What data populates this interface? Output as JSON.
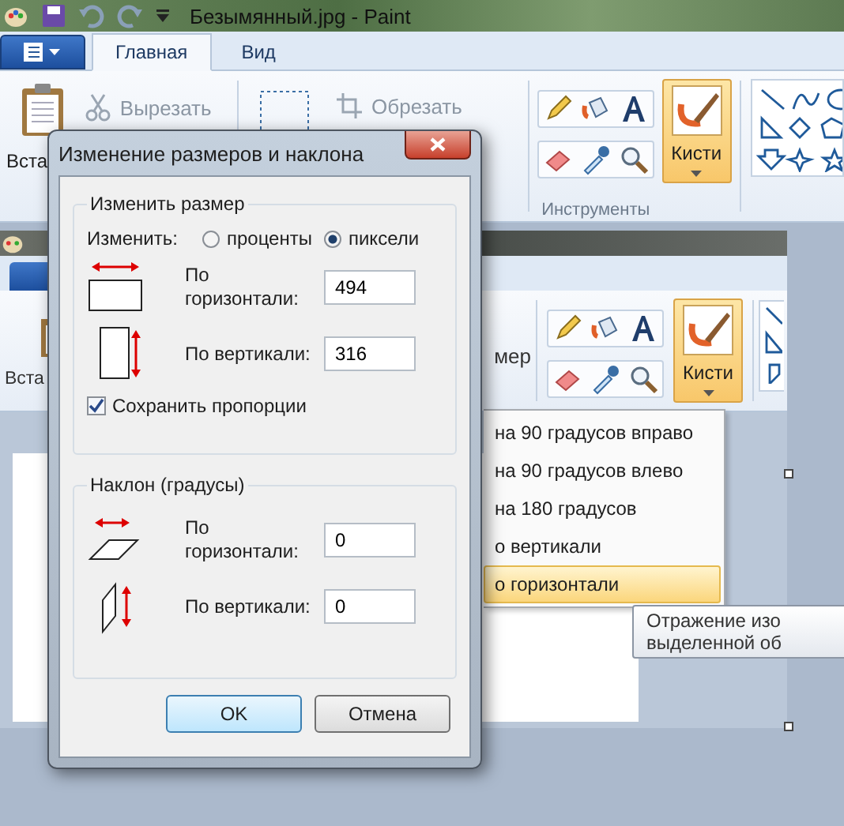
{
  "window": {
    "title": "Безымянный.jpg - Paint"
  },
  "ribbon": {
    "tabs": [
      {
        "label": "Главная",
        "selected": true
      },
      {
        "label": "Вид",
        "selected": false
      }
    ],
    "paste": "Вста",
    "cut": "Вырезать",
    "crop": "Обрезать",
    "tools_label": "Инструменты",
    "brushes": {
      "label": "Кисти",
      "selected": true
    }
  },
  "canvas_image": {
    "paste": "Вста",
    "resize_fragment": "мер",
    "brushes": "Кисти",
    "menu": [
      {
        "label": "на 90 градусов вправо",
        "selected": false
      },
      {
        "label": "на 90 градусов влево",
        "selected": false
      },
      {
        "label": "на 180 градусов",
        "selected": false
      },
      {
        "label": "о вертикали",
        "selected": false
      },
      {
        "label": "о горизонтали",
        "selected": true
      }
    ],
    "tooltip": "Отражение изо\nвыделенной об"
  },
  "dialog": {
    "title": "Изменение размеров и наклона",
    "resize": {
      "legend": "Изменить размер",
      "by_label": "Изменить:",
      "units": [
        {
          "label": "проценты",
          "selected": false
        },
        {
          "label": "пиксели",
          "selected": true
        }
      ],
      "fields": [
        {
          "label": "По горизонтали:",
          "value": "494"
        },
        {
          "label": "По вертикали:",
          "value": "316"
        }
      ],
      "keep_ratio": {
        "label": "Сохранить пропорции",
        "checked": true
      }
    },
    "skew": {
      "legend": "Наклон (градусы)",
      "fields": [
        {
          "label": "По горизонтали:",
          "value": "0"
        },
        {
          "label": "По вертикали:",
          "value": "0"
        }
      ]
    },
    "buttons": [
      {
        "label": "OK",
        "default": true
      },
      {
        "label": "Отмена",
        "default": false
      }
    ]
  }
}
